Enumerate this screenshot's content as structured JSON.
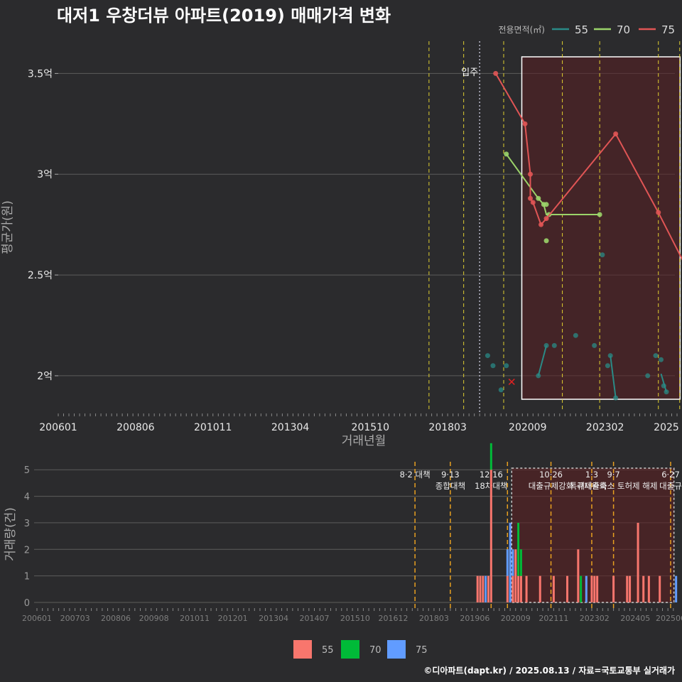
{
  "title": "대저1 우창더뷰 아파트(2019) 매매가격 변화",
  "legend_title": "전용면적(㎡)",
  "footer": "©디아파트(dapt.kr) / 2025.08.13 / 자료=국토교통부 실거래가",
  "colors": {
    "bg": "#2b2b2d",
    "s55": "#2a8a86",
    "s70": "#9bd46a",
    "s75": "#e05555",
    "b55": "#f8766d",
    "b70": "#00ba38",
    "b75": "#619cff",
    "event_line": "#e0d030",
    "event_line2": "#e8a020"
  },
  "chart_data": [
    {
      "type": "line",
      "title": "대저1 우창더뷰 아파트(2019) 매매가격 변화",
      "xlabel": "거래년월",
      "ylabel": "평균가(원)",
      "x_ticks": [
        "200601",
        "200806",
        "201011",
        "201304",
        "201510",
        "201803",
        "202009",
        "202302",
        "2025"
      ],
      "y_ticks": [
        {
          "value": 2.0,
          "label": "2억"
        },
        {
          "value": 2.5,
          "label": "2.5억"
        },
        {
          "value": 3.0,
          "label": "3억"
        },
        {
          "value": 3.5,
          "label": "3.5억"
        }
      ],
      "ylim": [
        1.82,
        3.66
      ],
      "legend_position": "top-right",
      "annotations": [
        {
          "text": "입주",
          "date": "2019-03"
        }
      ],
      "event_lines": [
        "2017-08",
        "2018-09",
        "2019-12",
        "2021-10",
        "2022-12",
        "2024-10",
        "2025-06"
      ],
      "highlight_period": [
        "2020-06",
        "2025-08"
      ],
      "series": [
        {
          "name": "55",
          "line": [
            [
              "2021-01",
              2.0
            ],
            [
              "2021-04",
              2.15
            ]
          ],
          "line2": [
            [
              "2023-04",
              2.1
            ],
            [
              "2023-06",
              1.89
            ]
          ],
          "line3": [
            [
              "2024-11",
              2.01
            ],
            [
              "2025-01",
              1.92
            ]
          ],
          "points": [
            [
              "2019-06",
              2.1
            ],
            [
              "2019-08",
              2.05
            ],
            [
              "2019-11",
              1.93
            ],
            [
              "2020-01",
              2.05
            ],
            [
              "2021-01",
              2.0
            ],
            [
              "2021-04",
              2.15
            ],
            [
              "2021-07",
              2.15
            ],
            [
              "2022-03",
              2.2
            ],
            [
              "2022-10",
              2.15
            ],
            [
              "2023-01",
              2.6
            ],
            [
              "2023-03",
              2.05
            ],
            [
              "2023-04",
              2.1
            ],
            [
              "2023-06",
              1.89
            ],
            [
              "2024-06",
              2.0
            ],
            [
              "2024-09",
              2.1
            ],
            [
              "2024-11",
              2.08
            ],
            [
              "2024-12",
              1.95
            ],
            [
              "2025-01",
              1.92
            ]
          ]
        },
        {
          "name": "70",
          "line": [
            [
              "2020-01",
              3.1
            ],
            [
              "2021-01",
              2.88
            ],
            [
              "2021-03",
              2.85
            ],
            [
              "2021-04",
              2.8
            ],
            [
              "2022-12",
              2.8
            ]
          ],
          "points": [
            [
              "2020-01",
              3.1
            ],
            [
              "2021-01",
              2.88
            ],
            [
              "2021-03",
              2.85
            ],
            [
              "2021-04",
              2.85
            ],
            [
              "2021-05",
              2.8
            ],
            [
              "2021-04",
              2.67
            ],
            [
              "2022-12",
              2.8
            ]
          ]
        },
        {
          "name": "75",
          "line": [
            [
              "2019-09",
              3.5
            ],
            [
              "2020-08",
              3.25
            ],
            [
              "2020-10",
              3.0
            ],
            [
              "2020-10",
              2.88
            ],
            [
              "2020-11",
              2.86
            ],
            [
              "2021-02",
              2.75
            ],
            [
              "2021-04",
              2.78
            ],
            [
              "2023-06",
              3.2
            ],
            [
              "2024-10",
              2.81
            ],
            [
              "2025-08",
              2.55
            ]
          ],
          "points": [
            [
              "2019-09",
              3.5
            ],
            [
              "2020-08",
              3.25
            ],
            [
              "2020-10",
              3.0
            ],
            [
              "2020-10",
              2.88
            ],
            [
              "2020-11",
              2.86
            ],
            [
              "2021-02",
              2.75
            ],
            [
              "2021-04",
              2.78
            ],
            [
              "2023-06",
              3.2
            ],
            [
              "2024-10",
              2.81
            ],
            [
              "2025-08",
              2.55
            ]
          ],
          "cancelled": [
            [
              "2020-03",
              1.97
            ]
          ]
        }
      ]
    },
    {
      "type": "bar",
      "xlabel": "",
      "ylabel": "거래량(건)",
      "x_ticks": [
        "200601",
        "200703",
        "200806",
        "200908",
        "201011",
        "201201",
        "201304",
        "201407",
        "201510",
        "201612",
        "201803",
        "201906",
        "202009",
        "202111",
        "202302",
        "202405",
        "202506"
      ],
      "y_ticks": [
        0,
        1,
        2,
        3,
        4,
        5
      ],
      "ylim": [
        0,
        5.3
      ],
      "legend_position": "bottom",
      "legend": [
        "55",
        "70",
        "75"
      ],
      "policy_events": [
        {
          "date": "2017-08",
          "lines": [
            "8·2 대책"
          ]
        },
        {
          "date": "2018-09",
          "lines": [
            "9·13",
            "종합대책"
          ]
        },
        {
          "date": "2019-12",
          "lines": [
            "12·16",
            "18차대책"
          ]
        },
        {
          "date": "2020-06",
          "lines": []
        },
        {
          "date": "2021-10",
          "lines": [
            "10·26",
            "대출규제강화"
          ]
        },
        {
          "date": "2023-01",
          "lines": [
            "1·3",
            "규제완화"
          ]
        },
        {
          "date": "2023-09",
          "lines": [
            "9·7",
            "특례대출축소 토허제 해제"
          ]
        },
        {
          "date": "2025-06",
          "lines": [
            "6·27",
            "대출규"
          ]
        }
      ],
      "highlight_period": [
        "2020-06",
        "2025-08"
      ],
      "stacks": [
        [
          "2019-07",
          1,
          0,
          0
        ],
        [
          "2019-08",
          1,
          0,
          0
        ],
        [
          "2019-09",
          1,
          0,
          0
        ],
        [
          "2019-10",
          0,
          0,
          1
        ],
        [
          "2019-11",
          1,
          0,
          0
        ],
        [
          "2019-12",
          5,
          1,
          0
        ],
        [
          "2020-06",
          1,
          0,
          1
        ],
        [
          "2020-07",
          0,
          0,
          3
        ],
        [
          "2020-08",
          1,
          0,
          1
        ],
        [
          "2020-09",
          2,
          0,
          0
        ],
        [
          "2020-10",
          1,
          2,
          0
        ],
        [
          "2020-11",
          1,
          1,
          0
        ],
        [
          "2021-01",
          1,
          0,
          0
        ],
        [
          "2021-06",
          1,
          0,
          0
        ],
        [
          "2021-11",
          1,
          0,
          0
        ],
        [
          "2022-04",
          1,
          0,
          0
        ],
        [
          "2022-08",
          2,
          0,
          0
        ],
        [
          "2022-09",
          0,
          1,
          0
        ],
        [
          "2022-11",
          0,
          0,
          1
        ],
        [
          "2023-01",
          1,
          0,
          0
        ],
        [
          "2023-02",
          1,
          0,
          0
        ],
        [
          "2023-03",
          1,
          0,
          0
        ],
        [
          "2023-09",
          1,
          0,
          0
        ],
        [
          "2024-02",
          1,
          0,
          0
        ],
        [
          "2024-03",
          1,
          0,
          0
        ],
        [
          "2024-06",
          3,
          0,
          0
        ],
        [
          "2024-08",
          1,
          0,
          0
        ],
        [
          "2024-10",
          1,
          0,
          0
        ],
        [
          "2025-02",
          1,
          0,
          0
        ],
        [
          "2025-08",
          0,
          0,
          1
        ]
      ]
    }
  ]
}
